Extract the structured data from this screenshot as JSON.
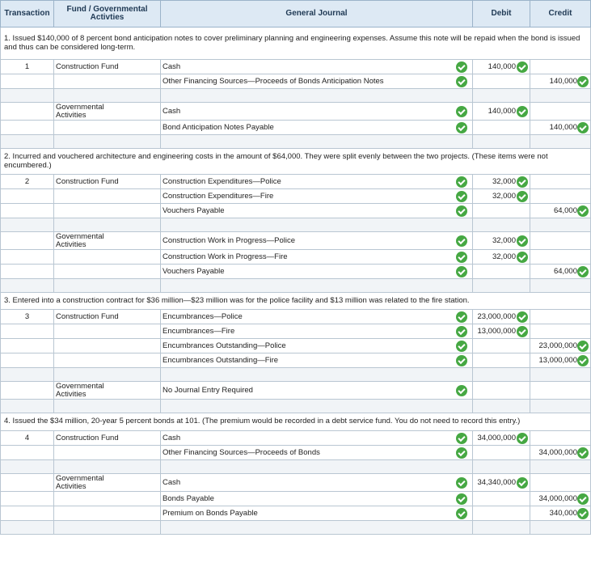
{
  "header": {
    "transaction": "Transaction",
    "fund": "Fund / Governmental Activties",
    "journal": "General Journal",
    "debit": "Debit",
    "credit": "Credit"
  },
  "items": [
    {
      "description": "1. Issued $140,000 of 8 percent bond anticipation notes to cover preliminary planning and engineering expenses. Assume this note will be repaid when the bond is issued and thus can be considered long-term.",
      "groups": [
        {
          "number": "1",
          "fund": "Construction Fund",
          "lines": [
            {
              "account": "Cash",
              "debit": "140,000",
              "credit": ""
            },
            {
              "account": "Other Financing Sources—Proceeds of Bonds Anticipation Notes",
              "debit": "",
              "credit": "140,000"
            }
          ]
        },
        {
          "number": "",
          "fund": "Governmental Activities",
          "lines": [
            {
              "account": "Cash",
              "debit": "140,000",
              "credit": ""
            },
            {
              "account": "Bond Anticipation Notes Payable",
              "debit": "",
              "credit": "140,000"
            }
          ]
        }
      ]
    },
    {
      "description": "2. Incurred and vouchered architecture and engineering costs in the amount of $64,000. They were split evenly between the two projects. (These items were not encumbered.)",
      "groups": [
        {
          "number": "2",
          "fund": "Construction Fund",
          "lines": [
            {
              "account": "Construction Expenditures—Police",
              "debit": "32,000",
              "credit": ""
            },
            {
              "account": "Construction Expenditures—Fire",
              "debit": "32,000",
              "credit": ""
            },
            {
              "account": "Vouchers Payable",
              "debit": "",
              "credit": "64,000"
            }
          ]
        },
        {
          "number": "",
          "fund": "Governmental Activities",
          "lines": [
            {
              "account": "Construction Work in Progress—Police",
              "debit": "32,000",
              "credit": ""
            },
            {
              "account": "Construction Work in Progress—Fire",
              "debit": "32,000",
              "credit": ""
            },
            {
              "account": "Vouchers Payable",
              "debit": "",
              "credit": "64,000"
            }
          ]
        }
      ]
    },
    {
      "description": "3. Entered into a construction contract for $36 million—$23 million was for the police facility and $13 million was related to the fire station.",
      "groups": [
        {
          "number": "3",
          "fund": "Construction Fund",
          "lines": [
            {
              "account": "Encumbrances—Police",
              "debit": "23,000,000",
              "credit": ""
            },
            {
              "account": "Encumbrances—Fire",
              "debit": "13,000,000",
              "credit": ""
            },
            {
              "account": "Encumbrances Outstanding—Police",
              "debit": "",
              "credit": "23,000,000"
            },
            {
              "account": "Encumbrances Outstanding—Fire",
              "debit": "",
              "credit": "13,000,000"
            }
          ]
        },
        {
          "number": "",
          "fund": "Governmental Activities",
          "lines": [
            {
              "account": "No Journal Entry Required",
              "debit": "",
              "credit": ""
            }
          ]
        }
      ]
    },
    {
      "description": "4. Issued the $34 million, 20-year 5 percent bonds at 101. (The premium would be recorded in a debt service fund. You do not need to record this entry.)",
      "groups": [
        {
          "number": "4",
          "fund": "Construction Fund",
          "lines": [
            {
              "account": "Cash",
              "debit": "34,000,000",
              "credit": ""
            },
            {
              "account": "Other Financing Sources—Proceeds of Bonds",
              "debit": "",
              "credit": "34,000,000"
            }
          ]
        },
        {
          "number": "",
          "fund": "Governmental Activities",
          "lines": [
            {
              "account": "Cash",
              "debit": "34,340,000",
              "credit": ""
            },
            {
              "account": "Bonds Payable",
              "debit": "",
              "credit": "34,000,000"
            },
            {
              "account": "Premium on Bonds Payable",
              "debit": "",
              "credit": "340,000"
            }
          ]
        }
      ]
    }
  ]
}
